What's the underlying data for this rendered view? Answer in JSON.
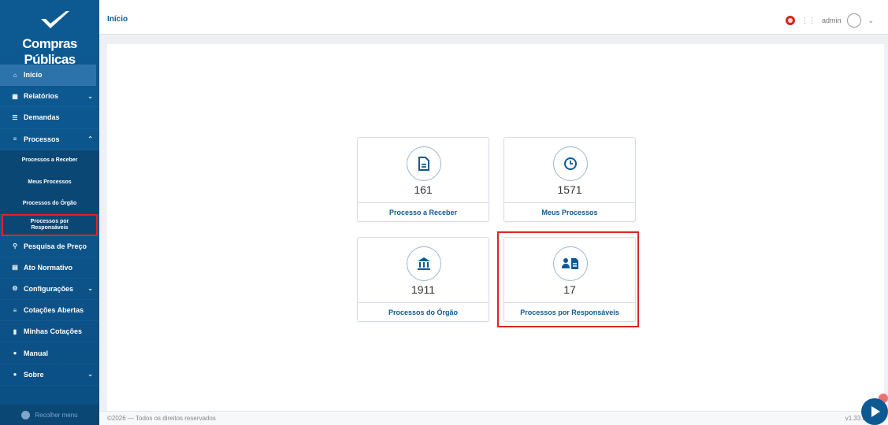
{
  "brand": {
    "name": "Compras Públicas"
  },
  "header": {
    "breadcrumb": "Início",
    "user": "admin",
    "notification_icon": "notification-flag-icon",
    "menu_icon": "apps-grid-icon"
  },
  "sidebar": {
    "items": [
      {
        "label": "Início",
        "icon": "home-icon",
        "active": true
      },
      {
        "label": "Relatórios",
        "icon": "reports-icon",
        "expandable": true
      },
      {
        "label": "Demandas",
        "icon": "list-icon"
      },
      {
        "label": "Processos",
        "icon": "menu-icon",
        "expanded": true
      }
    ],
    "sub_items": [
      {
        "label": "Processos a Receber"
      },
      {
        "label": "Meus Processos"
      },
      {
        "label": "Processos do Órgão"
      },
      {
        "label": "Processos por Responsáveis",
        "highlighted": true
      }
    ],
    "items_after": [
      {
        "label": "Pesquisa de Preço",
        "icon": "search-icon"
      },
      {
        "label": "Ato Normativo",
        "icon": "document-icon"
      },
      {
        "label": "Configurações",
        "icon": "gear-icon",
        "expandable": true
      },
      {
        "label": "Cotações Abertas",
        "icon": "menu-icon"
      },
      {
        "label": "Minhas Cotações",
        "icon": "bookmark-icon"
      },
      {
        "label": "Manual",
        "icon": "pin-icon"
      },
      {
        "label": "Sobre",
        "icon": "pin-icon",
        "expandable": true
      }
    ],
    "collapse_label": "Recolher menu"
  },
  "cards": [
    {
      "icon": "document-icon",
      "count": "161",
      "label": "Processo a Receber"
    },
    {
      "icon": "clock-icon",
      "count": "1571",
      "label": "Meus Processos"
    },
    {
      "icon": "bank-icon",
      "count": "1911",
      "label": "Processos do Órgão"
    },
    {
      "icon": "person-document-icon",
      "count": "17",
      "label": "Processos por Responsáveis",
      "highlighted": true
    }
  ],
  "footer": {
    "copyright": "©2026 — Todos os direitos reservados",
    "version": "v1.33.0-A"
  },
  "colors": {
    "primary": "#0d5a93",
    "highlight": "#e02424"
  }
}
